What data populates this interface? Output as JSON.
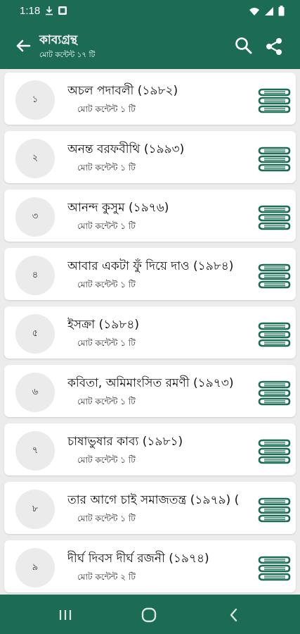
{
  "status_bar": {
    "time": "1:18"
  },
  "app_bar": {
    "title": "কাব্যগ্রন্থ",
    "subtitle": "মোট কন্টেন্ট ১৭ টি"
  },
  "theme": {
    "primary": "#1b6b55",
    "icon_green": "#1b6b55",
    "background": "#ececec"
  },
  "items": [
    {
      "number": "১",
      "title": "অচল পদাবলী (১৯৮২)",
      "meta": "মোট কন্টেন্ট ১ টি",
      "icon": "books-stack-icon"
    },
    {
      "number": "২",
      "title": "অনন্ত বরফবীথি (১৯৯৩)",
      "meta": "মোট কন্টেন্ট ১ টি",
      "icon": "books-stack-icon"
    },
    {
      "number": "৩",
      "title": "আনন্দ কুসুম (১৯৭৬)",
      "meta": "মোট কন্টেন্ট ১ টি",
      "icon": "books-stack-icon"
    },
    {
      "number": "৪",
      "title": "আবার একটা ফুঁ দিয়ে দাও (১৯৮৪)",
      "meta": "মোট কন্টেন্ট ১ টি",
      "icon": "books-stack-icon"
    },
    {
      "number": "৫",
      "title": "ইসক্রা (১৯৮৪)",
      "meta": "মোট কন্টেন্ট ১ টি",
      "icon": "books-stack-icon"
    },
    {
      "number": "৬",
      "title": "কবিতা, অমিমাংসিত রমণী (১৯৭৩)",
      "meta": "মোট কন্টেন্ট ১ টি",
      "icon": "books-stack-icon"
    },
    {
      "number": "৭",
      "title": "চাষাভুষার কাব্য (১৯৮১)",
      "meta": "মোট কন্টেন্ট ১ টি",
      "icon": "books-stack-icon"
    },
    {
      "number": "৮",
      "title": "তার আগে চাই সমাজতন্ত্র (১৯৭৯) (",
      "meta": "মোট কন্টেন্ট ১ টি",
      "icon": "books-stack-icon"
    },
    {
      "number": "৯",
      "title": "দীর্ঘ দিবস দীর্ঘ রজনী (১৯৭৪)",
      "meta": "মোট কন্টেন্ট ২ টি",
      "icon": "books-stack-icon"
    }
  ]
}
